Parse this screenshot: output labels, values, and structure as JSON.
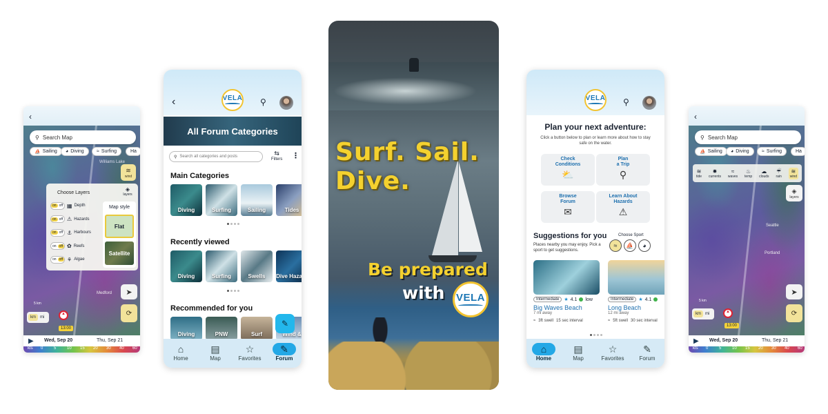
{
  "left_map": {
    "search_placeholder": "Search Map",
    "chips": [
      "Sailing",
      "Diving",
      "Surfing",
      "Ha"
    ],
    "place_label": "Williams Lake",
    "wind_label": "wind",
    "layers_label": "layers",
    "layers_panel": {
      "title": "Choose Layers",
      "rows": [
        {
          "on": "on",
          "off": "off",
          "label": "Depth"
        },
        {
          "on": "on",
          "off": "off",
          "label": "Hazards"
        },
        {
          "on": "on",
          "off": "off",
          "label": "Harbours"
        },
        {
          "on": "on",
          "off": "off",
          "label": "Reefs"
        },
        {
          "on": "on",
          "off": "off",
          "label": "Algae"
        }
      ]
    },
    "map_style": {
      "title": "Map style",
      "flat": "Flat",
      "satellite": "Satellite"
    },
    "place_label_2": "Medford",
    "scale_label": "5 km",
    "units": {
      "km": "km",
      "mi": "mi"
    },
    "time_flag": "13:00",
    "day1": "Wed, Sep 20",
    "day2": "Thu, Sep 21",
    "scale": [
      "kts",
      "0",
      "5",
      "10",
      "15",
      "20",
      "30",
      "40",
      "60"
    ]
  },
  "forum": {
    "logo": "VELA",
    "banner": "All Forum Categories",
    "search_placeholder": "Search all categories and posts",
    "filters_label": "Filters",
    "main_categories_title": "Main Categories",
    "main_categories": [
      "Diving",
      "Surfing",
      "Sailing",
      "Tides"
    ],
    "recently_viewed_title": "Recently viewed",
    "recently_viewed": [
      "Diving",
      "Surfing",
      "Swells",
      "Dive Hazard"
    ],
    "recommended_title": "Recommended for you",
    "recommended": [
      "Diving",
      "PNW",
      "Surf",
      "Wind &"
    ],
    "nav": [
      "Home",
      "Map",
      "Favorites",
      "Forum"
    ]
  },
  "poster": {
    "headline_1": "Surf. Sail.",
    "headline_2": "Dive.",
    "tag_1": "Be prepared",
    "tag_2": "with",
    "logo": "VELA"
  },
  "home": {
    "logo": "VELA",
    "title": "Plan your next adventure:",
    "subtitle": "Click a button below to plan or learn more about how to stay safe on the water.",
    "buttons": [
      {
        "line1": "Check",
        "line2": "Conditions"
      },
      {
        "line1": "Plan",
        "line2": "a Trip"
      },
      {
        "line1": "Browse",
        "line2": "Forum"
      },
      {
        "line1": "Learn About",
        "line2": "Hazards"
      }
    ],
    "suggestions_title": "Suggestions for you",
    "suggestions_sub": "Places nearby you may enjoy. Pick a sport to get suggestions.",
    "choose_sport": "Choose Sport",
    "cards": [
      {
        "level": "Intermediate",
        "rating": "4.1",
        "rating_label": "low",
        "name": "Big Waves Beach",
        "distance": "7 mi away",
        "swell": "3ft swell",
        "interval": "15 sec interval"
      },
      {
        "level": "Intermediate",
        "rating": "4.1",
        "rating_label": "",
        "name": "Long Beach",
        "distance": "12 mi away",
        "swell": "5ft swell",
        "interval": "30 sec interval"
      }
    ],
    "nav": [
      "Home",
      "Map",
      "Favorites",
      "Forum"
    ]
  },
  "right_map": {
    "search_placeholder": "Search Map",
    "chips": [
      "Sailing",
      "Diving",
      "Surfing",
      "Ha"
    ],
    "layers": [
      "tide",
      "currents",
      "waves",
      "temp",
      "clouds",
      "rain",
      "wind"
    ],
    "layers_label": "layers",
    "place_labels": [
      "Seattle",
      "Portland"
    ],
    "scale_label": "5 km",
    "units": {
      "km": "km",
      "mi": "mi"
    },
    "time_flag": "13:00",
    "day1": "Wed, Sep 20",
    "day2": "Thu, Sep 21",
    "scale": [
      "kts",
      "0",
      "5",
      "10",
      "15",
      "20",
      "30",
      "40",
      "60"
    ]
  }
}
